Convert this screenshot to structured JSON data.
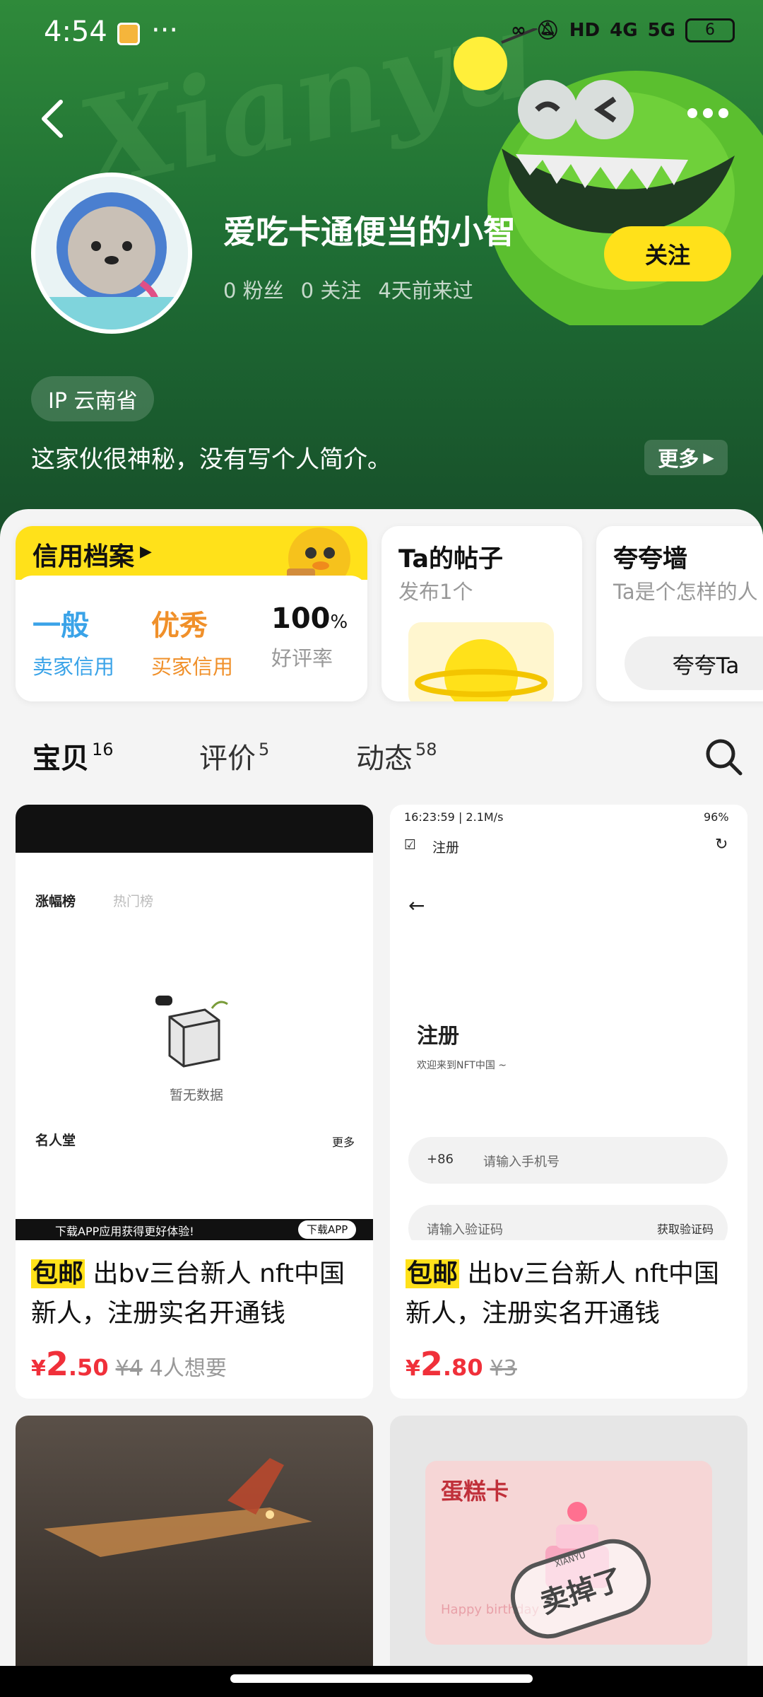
{
  "status_bar": {
    "time": "4:54",
    "more": "···",
    "battery": "6",
    "hd": "HD",
    "net1": "4G",
    "net2": "5G"
  },
  "profile": {
    "name": "爱吃卡通便当的小智",
    "fans": "0 粉丝",
    "following": "0 关注",
    "last_seen": "4天前来过",
    "follow_label": "关注",
    "ip": "IP 云南省",
    "bio": "这家伙很神秘，没有写个人简介。",
    "more_label": "更多",
    "watermark": "Xianyu"
  },
  "credit": {
    "title": "信用档案",
    "seller_value": "一般",
    "seller_label": "卖家信用",
    "buyer_value": "优秀",
    "buyer_label": "买家信用",
    "rate_value": "100",
    "rate_unit": "%",
    "rate_label": "好评率"
  },
  "posts_card": {
    "title": "Ta的帖子",
    "sub": "发布1个"
  },
  "praise_card": {
    "title": "夸夸墙",
    "sub": "Ta是个怎样的人",
    "button": "夸夸Ta"
  },
  "tabs": [
    {
      "label": "宝贝",
      "count": "16"
    },
    {
      "label": "评价",
      "count": "5"
    },
    {
      "label": "动态",
      "count": "58"
    }
  ],
  "products": [
    {
      "tag": "包邮",
      "title": "出bv三台新人 nft中国新人，注册实名开通钱",
      "currency": "¥",
      "price_int": "2",
      "price_dec": ".50",
      "orig": "¥4",
      "wants": "4人想要",
      "thumb": {
        "tab1": "涨幅榜",
        "tab2": "热门榜",
        "empty": "暂无数据",
        "hall": "名人堂",
        "more": "更多",
        "banner": "下载APP应用获得更好体验!",
        "dl": "下载APP"
      }
    },
    {
      "tag": "包邮",
      "title": "出bv三台新人 nft中国新人，注册实名开通钱",
      "currency": "¥",
      "price_int": "2",
      "price_dec": ".80",
      "orig": "¥3",
      "wants": "",
      "thumb": {
        "statusline": "16:23:59 | 2.1M/s",
        "battery": "96%",
        "nav": "注册",
        "heading": "注册",
        "welcome": "欢迎来到NFT中国 ~",
        "cc": "+86",
        "phone_ph": "请输入手机号",
        "code_ph": "请输入验证码",
        "get_code": "获取验证码"
      }
    },
    {
      "image": "rainy-airplane"
    },
    {
      "card_title": "蛋糕卡",
      "stamp": "卖掉了",
      "card_sub": "Happy birthday",
      "stamp_word": "XIANYU"
    }
  ]
}
